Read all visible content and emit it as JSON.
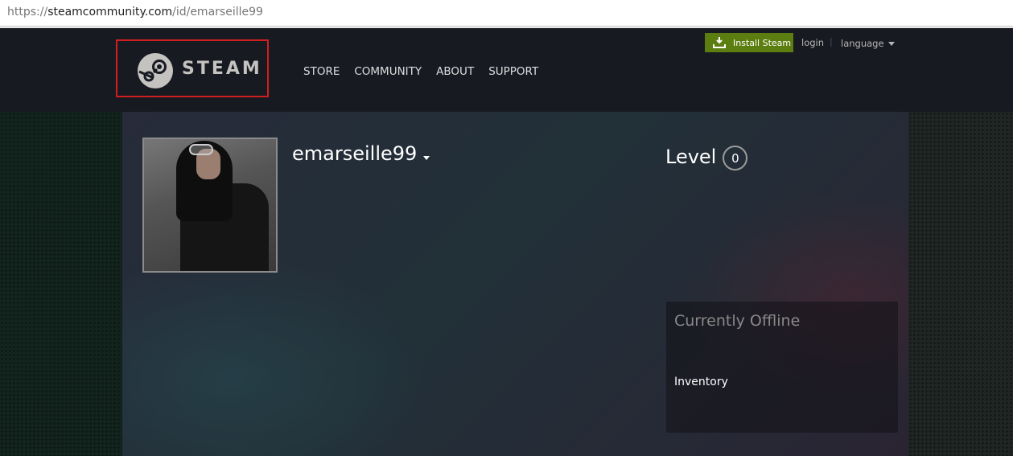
{
  "browser": {
    "url_scheme": "https://",
    "url_host": "steamcommunity.com",
    "url_path": "/id/emarseille99"
  },
  "header": {
    "logo_text": "STEAM",
    "logo_reg": "®",
    "nav": [
      "STORE",
      "COMMUNITY",
      "ABOUT",
      "SUPPORT"
    ],
    "install_label": "Install Steam",
    "login_label": "login",
    "separator": "|",
    "language_label": "language"
  },
  "profile": {
    "persona_name": "emarseille99",
    "level_label": "Level",
    "level_value": "0",
    "status": "Currently Offline",
    "inventory_label": "Inventory"
  },
  "colors": {
    "header_bg": "#171a21",
    "install_green": "#5c7e10",
    "highlight_red": "#d11f1f"
  }
}
